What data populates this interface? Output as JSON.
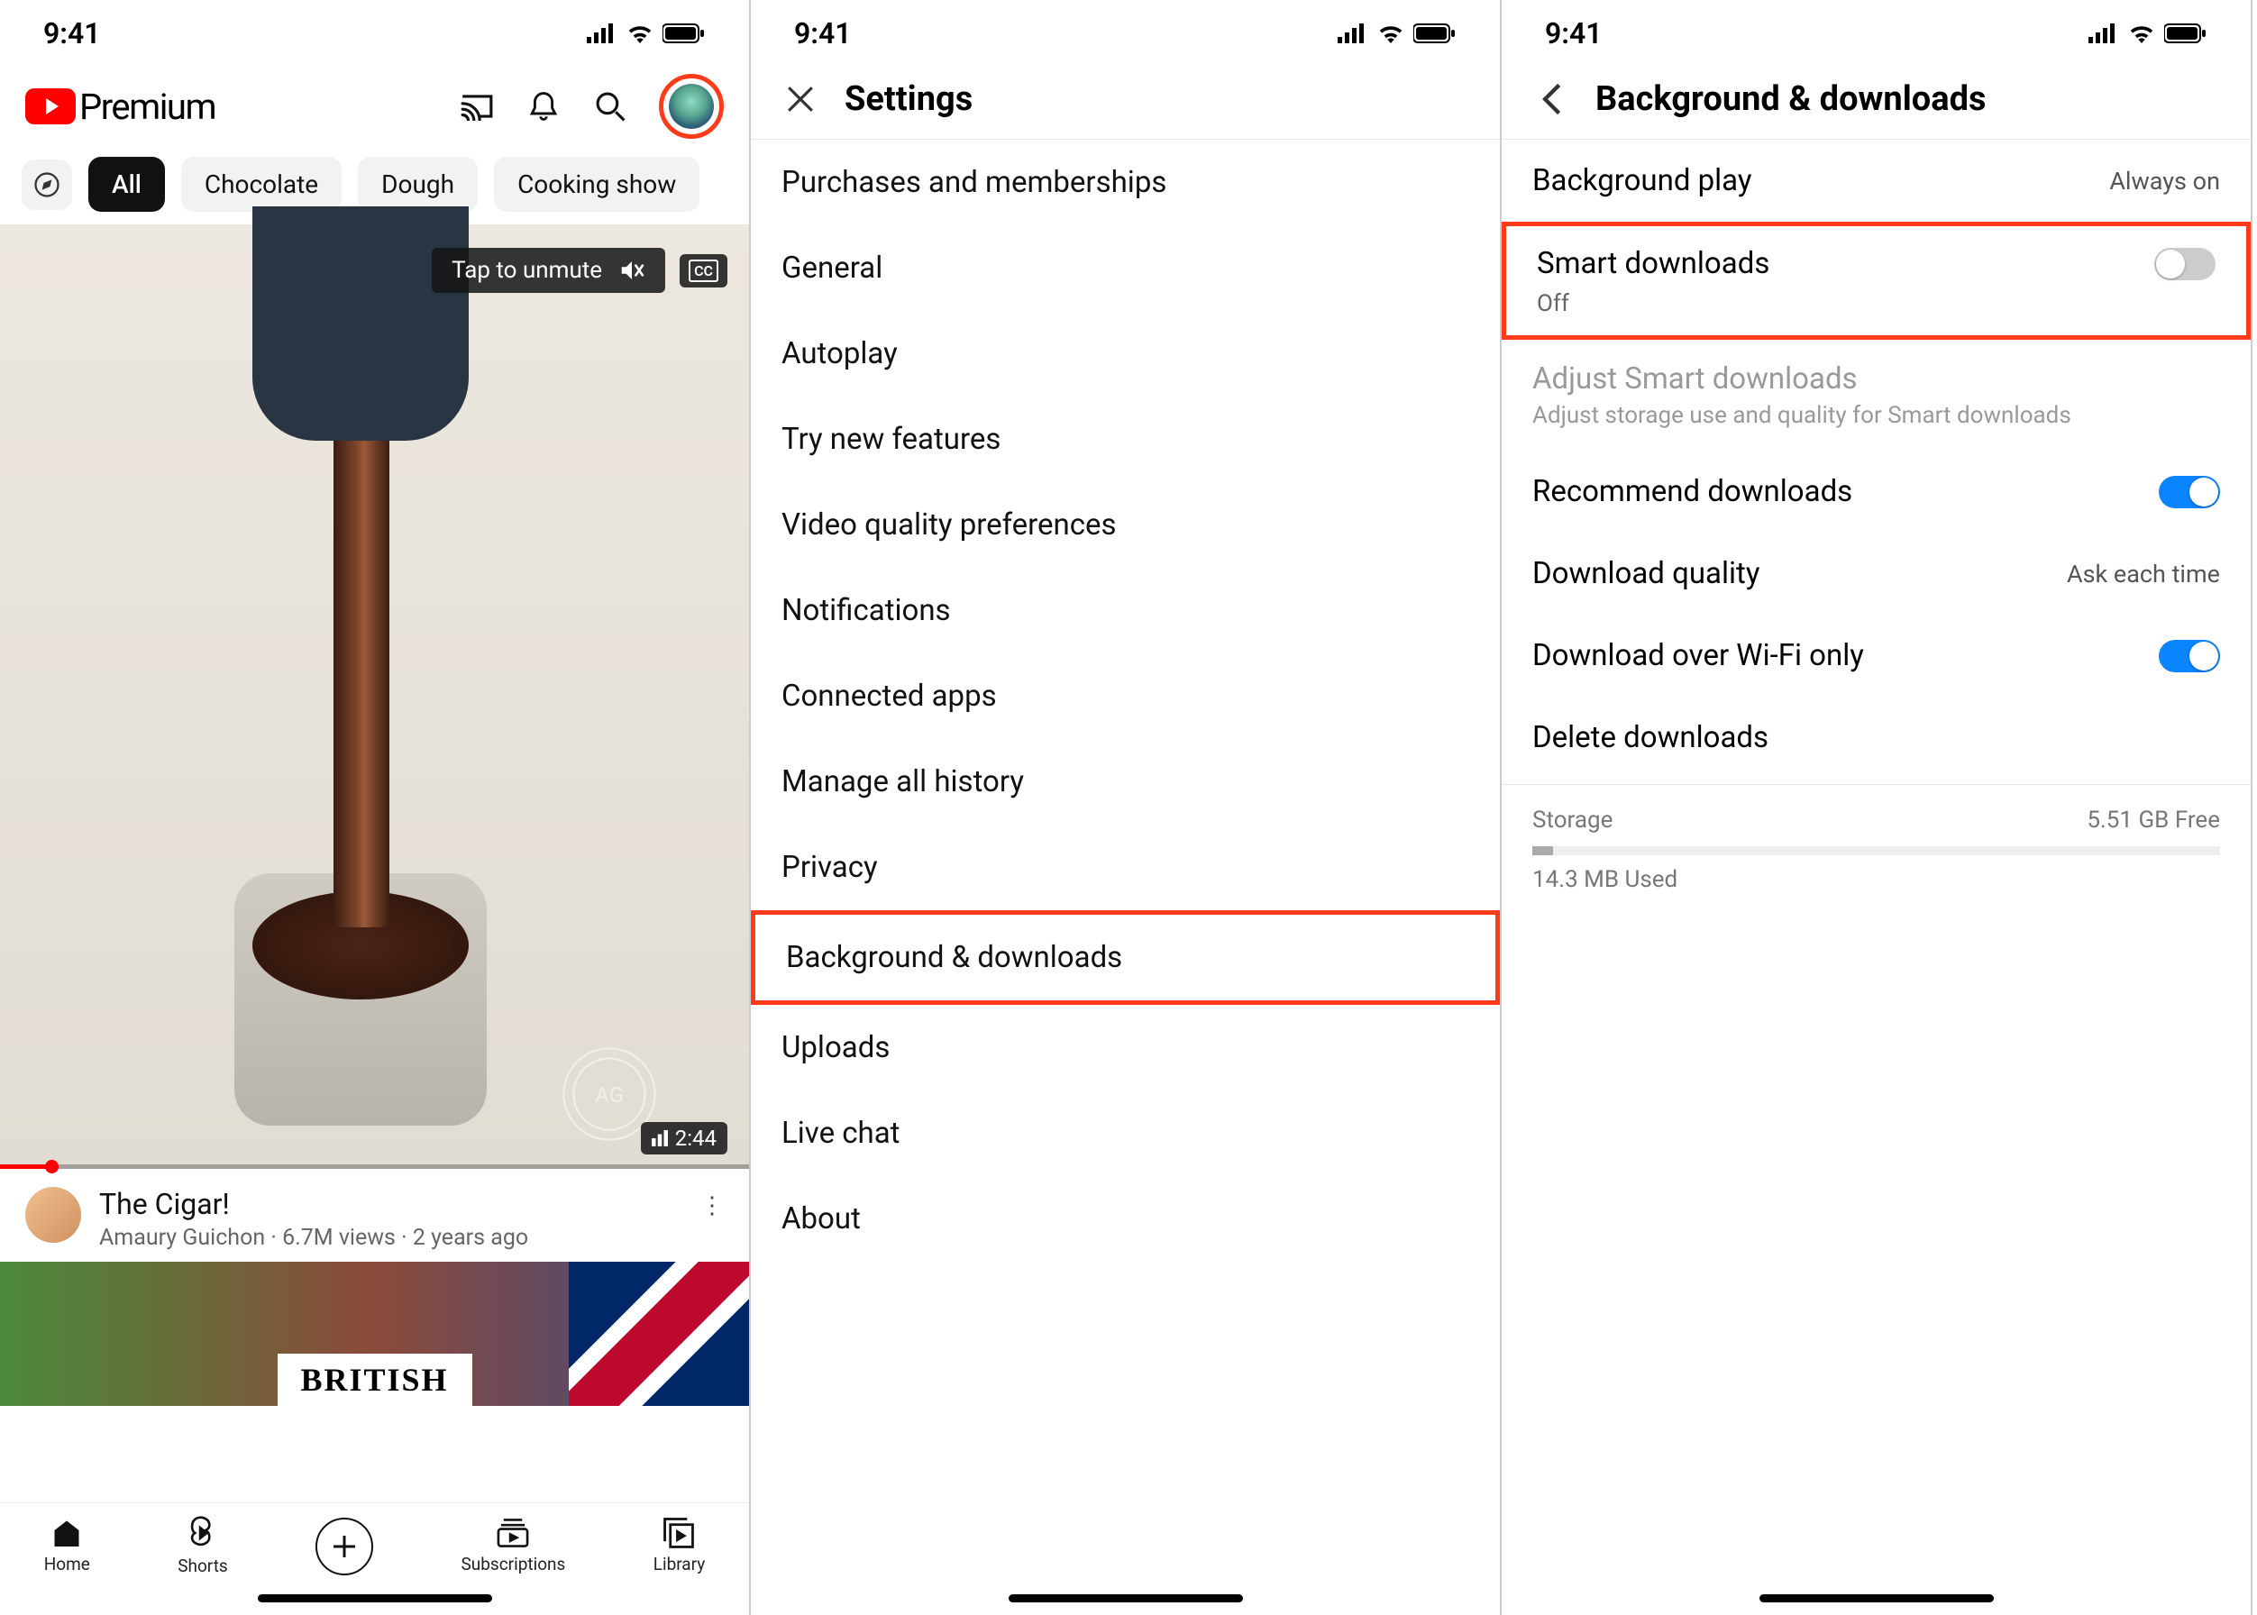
{
  "status": {
    "time": "9:41"
  },
  "screen1": {
    "brand": "Premium",
    "chips": {
      "all": "All",
      "c1": "Chocolate",
      "c2": "Dough",
      "c3": "Cooking show"
    },
    "video": {
      "unmute": "Tap to unmute",
      "cc": "CC",
      "duration": "2:44",
      "title": "The Cigar!",
      "channel": "Amaury Guichon",
      "views": "6.7M views",
      "age": "2 years ago"
    },
    "thumb2_text": "BRITISH",
    "nav": {
      "home": "Home",
      "shorts": "Shorts",
      "subs": "Subscriptions",
      "library": "Library"
    }
  },
  "screen2": {
    "title": "Settings",
    "items": {
      "i0": "Purchases and memberships",
      "i1": "General",
      "i2": "Autoplay",
      "i3": "Try new features",
      "i4": "Video quality preferences",
      "i5": "Notifications",
      "i6": "Connected apps",
      "i7": "Manage all history",
      "i8": "Privacy",
      "i9": "Background & downloads",
      "i10": "Uploads",
      "i11": "Live chat",
      "i12": "About"
    }
  },
  "screen3": {
    "title": "Background & downloads",
    "bgplay": {
      "label": "Background play",
      "value": "Always on"
    },
    "smart": {
      "label": "Smart downloads",
      "status": "Off"
    },
    "adjust": {
      "title": "Adjust Smart downloads",
      "desc": "Adjust storage use and quality for Smart downloads"
    },
    "recommend": "Recommend downloads",
    "quality": {
      "label": "Download quality",
      "value": "Ask each time"
    },
    "wifi": "Download over Wi-Fi only",
    "delete": "Delete downloads",
    "storage": {
      "label": "Storage",
      "free": "5.51 GB Free",
      "used": "14.3 MB Used"
    }
  }
}
